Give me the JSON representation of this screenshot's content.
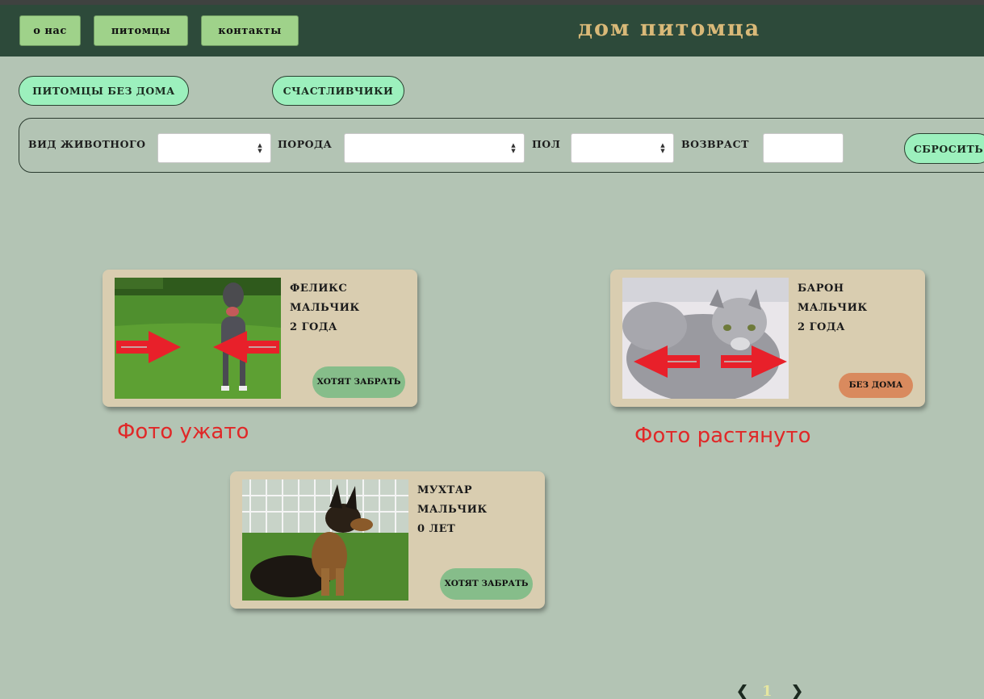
{
  "nav": {
    "about": "о нас",
    "pets": "питомцы",
    "contacts": "контакты"
  },
  "site_title": "дом питомца",
  "tabs": {
    "homeless": "ПИТОМЦЫ БЕЗ ДОМА",
    "lucky": "СЧАСТЛИВЧИКИ"
  },
  "filters": {
    "species_label": "ВИД ЖИВОТНОГО",
    "breed_label": "ПОРОДА",
    "sex_label": "ПОЛ",
    "age_label": "ВОЗВРАСТ",
    "reset_label": "СБРОСИТЬ",
    "species_value": "",
    "breed_value": "",
    "sex_value": "",
    "age_value": ""
  },
  "cards": [
    {
      "name": "ФЕЛИКС",
      "sex": "МАЛЬЧИК",
      "age": "2 ГОДА",
      "status": "ХОТЯТ ЗАБРАТЬ",
      "photo": "dog-pitbull"
    },
    {
      "name": "БАРОН",
      "sex": "МАЛЬЧИК",
      "age": "2 ГОДА",
      "status": "БЕЗ ДОМА",
      "photo": "cat-siberian"
    },
    {
      "name": "МУХТАР",
      "sex": "МАЛЬЧИК",
      "age": "0 ЛЕТ",
      "status": "ХОТЯТ ЗАБРАТЬ",
      "photo": "puppy-shepherd"
    }
  ],
  "annotations": {
    "squeezed": "Фото ужато",
    "stretched": "Фото растянуто"
  },
  "pagination": {
    "prev": "❮",
    "current": "1",
    "next": "❯"
  },
  "colors": {
    "header_bg": "#2d4a3a",
    "page_bg": "#b3c4b4",
    "nav_button": "#9fd28a",
    "pill": "#9cf0bd",
    "card_bg": "#d9cdb0",
    "status_green": "#86bd8a",
    "status_orange": "#d98a5e",
    "annotation_red": "#e02828",
    "title_gold": "#d9b978"
  }
}
